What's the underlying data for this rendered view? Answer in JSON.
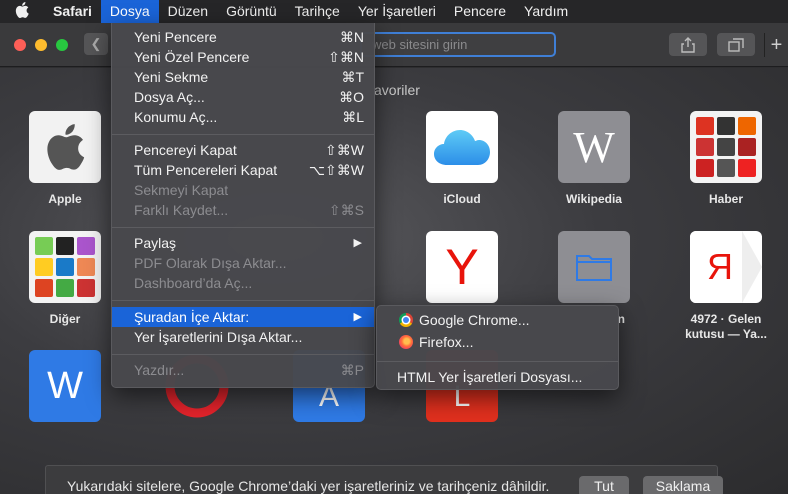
{
  "menubar": {
    "apple_icon": "apple-logo-icon",
    "items": [
      "Safari",
      "Dosya",
      "Düzen",
      "Görüntü",
      "Tarihçe",
      "Yer İşaretleri",
      "Pencere",
      "Yardım"
    ],
    "active": "Dosya"
  },
  "toolbar": {
    "url_placeholder": "web sitesini girin",
    "plus": "+"
  },
  "favorites": {
    "heading": "avoriler",
    "tiles": {
      "apple": {
        "label": "Apple"
      },
      "icloud": {
        "label": "iCloud"
      },
      "wikipedia": {
        "label": "Wikipedia",
        "glyph": "W"
      },
      "haber": {
        "label": "Haber"
      },
      "diger": {
        "label": "Diğer"
      },
      "yandex": {
        "glyph": "Y"
      },
      "folder": {
        "label_fragment": "n"
      },
      "yamail": {
        "label": "4972 · Gelen kutusu — Ya...",
        "glyph": "Я"
      },
      "word": {
        "glyph": "W"
      },
      "a_tile": {
        "glyph": "A"
      },
      "l_tile": {
        "glyph": "L"
      }
    }
  },
  "file_menu": {
    "items": [
      {
        "label": "Yeni Pencere",
        "shortcut": "⌘N",
        "enabled": true
      },
      {
        "label": "Yeni Özel Pencere",
        "shortcut": "⇧⌘N",
        "enabled": true
      },
      {
        "label": "Yeni Sekme",
        "shortcut": "⌘T",
        "enabled": true
      },
      {
        "label": "Dosya Aç...",
        "shortcut": "⌘O",
        "enabled": true
      },
      {
        "label": "Konumu Aç...",
        "shortcut": "⌘L",
        "enabled": true
      },
      {
        "label": "Pencereyi Kapat",
        "shortcut": "⇧⌘W",
        "enabled": true
      },
      {
        "label": "Tüm Pencereleri Kapat",
        "shortcut": "⌥⇧⌘W",
        "enabled": true
      },
      {
        "label": "Sekmeyi Kapat",
        "shortcut": "",
        "enabled": false
      },
      {
        "label": "Farklı Kaydet...",
        "shortcut": "⇧⌘S",
        "enabled": false
      },
      {
        "label": "Paylaş",
        "shortcut": "▶",
        "enabled": true
      },
      {
        "label": "PDF Olarak Dışa Aktar...",
        "shortcut": "",
        "enabled": false
      },
      {
        "label": "Dashboard’da Aç...",
        "shortcut": "",
        "enabled": false
      },
      {
        "label": "Şuradan İçe Aktar:",
        "shortcut": "▶",
        "enabled": true,
        "selected": true
      },
      {
        "label": "Yer İşaretlerini Dışa Aktar...",
        "shortcut": "",
        "enabled": true
      },
      {
        "label": "Yazdır...",
        "shortcut": "⌘P",
        "enabled": false
      }
    ]
  },
  "import_submenu": {
    "items": [
      {
        "label": "Google Chrome...",
        "icon": "chrome-icon"
      },
      {
        "label": "Firefox...",
        "icon": "firefox-icon"
      },
      {
        "label": "HTML Yer İşaretleri Dosyası...",
        "icon": ""
      }
    ]
  },
  "import_bar": {
    "message": "Yukarıdaki sitelere, Google Chrome’daki yer işaretleriniz ve tarihçeniz dâhildir.",
    "keep_label": "Tut",
    "dismiss_label": "Saklama"
  },
  "colors": {
    "menu_highlight": "#1a64d8",
    "traffic_red": "#fe5f57",
    "traffic_yellow": "#febc2e",
    "traffic_green": "#28c840"
  }
}
